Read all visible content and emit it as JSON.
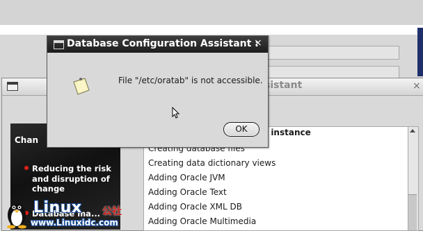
{
  "dialog": {
    "title": "Database Configuration Assistant :",
    "close_glyph": "×",
    "message": "File \"/etc/oratab\" is not accessible.",
    "ok_label": "OK"
  },
  "main_window": {
    "title_fragment": "sistant",
    "close_glyph": "×"
  },
  "banner": {
    "heading_fragment": "Chan",
    "bullet_1": "Reducing the risk and disruption of change",
    "bullet_2_fragment": "Database ma..."
  },
  "steps": {
    "current_fragment": "e instance",
    "items": [
      "Creating database files",
      "Creating data dictionary views",
      "Adding Oracle JVM",
      "Adding Oracle Text",
      "Adding Oracle XML DB",
      "Adding Oracle Multimedia"
    ]
  },
  "watermark": {
    "brand": "Linux",
    "brand_cn": "公社",
    "url": "www.Linuxidc.com"
  },
  "colors": {
    "dialog_titlebar": "#2a2a2a",
    "banner_bg": "#1a1a1a",
    "bullet": "#e0201a",
    "watermark_blue": "#1b4f9a",
    "watermark_red": "#c8201c"
  },
  "icons": [
    "window-menu-icon",
    "close-icon",
    "sticky-note-icon",
    "mouse-cursor-icon",
    "tux-penguin-icon",
    "scroll-up-arrow-icon"
  ]
}
